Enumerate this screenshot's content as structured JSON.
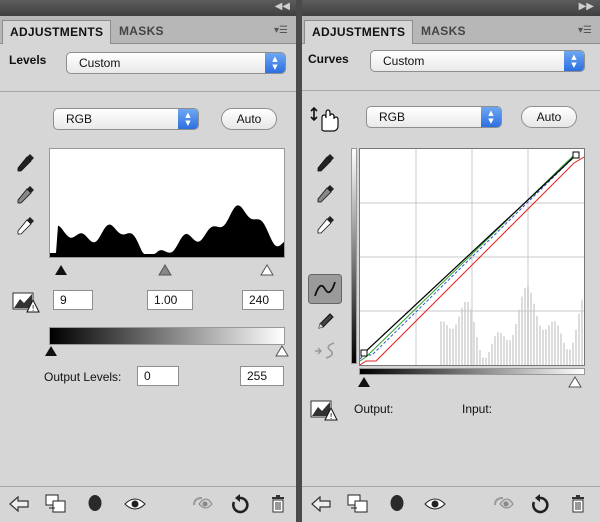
{
  "levels_panel": {
    "tabs": [
      {
        "label": "ADJUSTMENTS",
        "active": true
      },
      {
        "label": "MASKS",
        "active": false
      }
    ],
    "title": "Levels",
    "preset": "Custom",
    "channel": "RGB",
    "auto_label": "Auto",
    "input_black": "9",
    "input_gamma": "1.00",
    "input_white": "240",
    "output_levels_label": "Output Levels:",
    "output_black": "0",
    "output_white": "255"
  },
  "curves_panel": {
    "tabs": [
      {
        "label": "ADJUSTMENTS",
        "active": true
      },
      {
        "label": "MASKS",
        "active": false
      }
    ],
    "title": "Curves",
    "preset": "Custom",
    "channel": "RGB",
    "auto_label": "Auto",
    "output_label": "Output:",
    "input_label": "Input:"
  },
  "colors": {
    "panel_bg": "#d6d6d6",
    "select_arrow": "#2c6fe0",
    "curve_rgb": "#000000",
    "curve_red": "#e02020",
    "curve_green": "#2aa02a",
    "curve_blue": "#2a4fd0"
  },
  "icons": {
    "sampler_icons": [
      "black-point-eyedropper-icon",
      "gray-point-eyedropper-icon",
      "white-point-eyedropper-icon"
    ],
    "footer_icons": [
      "back-arrow-icon",
      "clip-to-layer-icon",
      "layer-mask-icon",
      "visibility-eye-icon",
      "previous-state-icon",
      "reset-icon",
      "delete-trash-icon"
    ]
  }
}
